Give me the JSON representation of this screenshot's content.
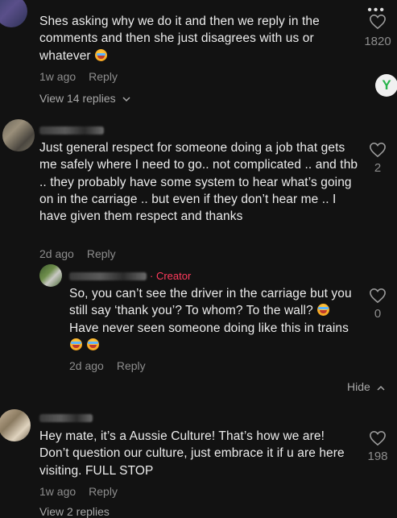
{
  "top_icons": {
    "more": "more-dots-icon",
    "badge": "Y"
  },
  "comments": [
    {
      "text": "Shes asking why we do it and then we reply in the comments and then she just disagrees with us or whatever",
      "time": "1w ago",
      "reply": "Reply",
      "likes": "1820",
      "view_replies": "View 14 replies"
    },
    {
      "text": "Just general respect for someone doing a job that gets me safely where I need to go.. not complicated .. and thb .. they probably have some system to hear what’s going on in the carriage .. but even if they don’t hear me .. I have given them respect and thanks",
      "time": "2d ago",
      "reply": "Reply",
      "likes": "2"
    },
    {
      "creator_tag": "· Creator",
      "text_a": "So, you can’t see the driver in the carriage but you still say ‘thank you’? To whom? To the wall?",
      "text_b": "Have never seen someone doing like this in trains",
      "time": "2d ago",
      "reply": "Reply",
      "likes": "0",
      "hide": "Hide"
    },
    {
      "text": "Hey mate, it’s a Aussie Culture! That’s how we are! Don’t question our culture, just embrace it if u are here visiting. FULL STOP",
      "time": "1w ago",
      "reply": "Reply",
      "likes": "198",
      "view_replies": "View 2 replies"
    }
  ]
}
